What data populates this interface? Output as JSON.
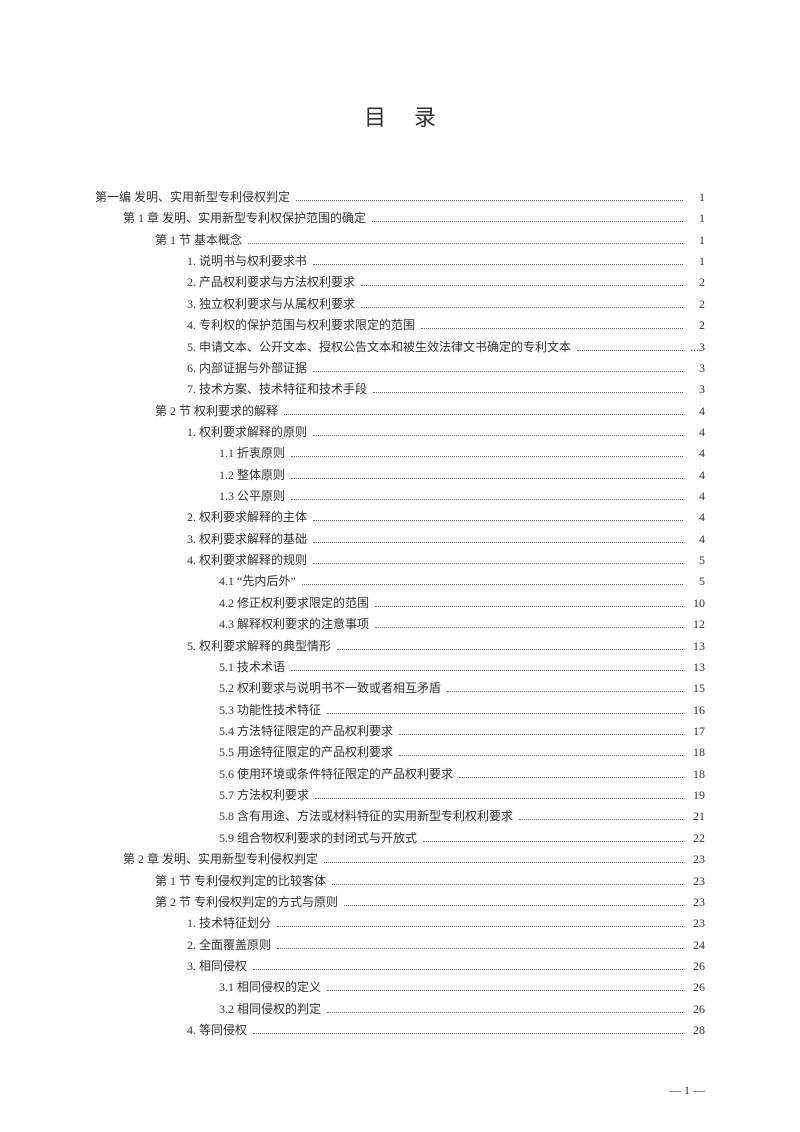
{
  "title": "目录",
  "page_footer": "— 1 —",
  "entries": [
    {
      "level": 0,
      "text": "第一编  发明、实用新型专利侵权判定",
      "page": "1"
    },
    {
      "level": 1,
      "text": "第 1 章  发明、实用新型专利权保护范围的确定",
      "page": "1"
    },
    {
      "level": 2,
      "text": "第 1 节  基本概念",
      "page": "1"
    },
    {
      "level": 3,
      "text": "1. 说明书与权利要求书",
      "page": "1"
    },
    {
      "level": 3,
      "text": "2. 产品权利要求与方法权利要求",
      "page": "2"
    },
    {
      "level": 3,
      "text": "3. 独立权利要求与从属权利要求",
      "page": "2"
    },
    {
      "level": 3,
      "text": "4. 专利权的保护范围与权利要求限定的范围",
      "page": "2"
    },
    {
      "level": 3,
      "text": "5. 申请文本、公开文本、授权公告文本和被生效法律文书确定的专利文本",
      "page": "...3"
    },
    {
      "level": 3,
      "text": "6. 内部证据与外部证据",
      "page": "3"
    },
    {
      "level": 3,
      "text": "7. 技术方案、技术特征和技术手段",
      "page": "3"
    },
    {
      "level": 2,
      "text": "第 2 节  权利要求的解释",
      "page": "4"
    },
    {
      "level": 3,
      "text": "1. 权利要求解释的原则",
      "page": "4"
    },
    {
      "level": 4,
      "text": "1.1 折衷原则",
      "page": "4"
    },
    {
      "level": 4,
      "text": "1.2 整体原则",
      "page": "4"
    },
    {
      "level": 4,
      "text": "1.3 公平原则",
      "page": "4"
    },
    {
      "level": 3,
      "text": "2. 权利要求解释的主体",
      "page": "4"
    },
    {
      "level": 3,
      "text": "3. 权利要求解释的基础",
      "page": "4"
    },
    {
      "level": 3,
      "text": "4. 权利要求解释的规则",
      "page": "5"
    },
    {
      "level": 4,
      "text": "4.1 “先内后外”",
      "page": "5"
    },
    {
      "level": 4,
      "text": "4.2 修正权利要求限定的范围",
      "page": "10"
    },
    {
      "level": 4,
      "text": "4.3 解释权利要求的注意事项",
      "page": "12"
    },
    {
      "level": 3,
      "text": "5. 权利要求解释的典型情形",
      "page": "13"
    },
    {
      "level": 4,
      "text": "5.1 技术术语",
      "page": "13"
    },
    {
      "level": 4,
      "text": "5.2 权利要求与说明书不一致或者相互矛盾",
      "page": "15"
    },
    {
      "level": 4,
      "text": "5.3 功能性技术特征",
      "page": "16"
    },
    {
      "level": 4,
      "text": "5.4 方法特征限定的产品权利要求",
      "page": "17"
    },
    {
      "level": 4,
      "text": "5.5 用途特征限定的产品权利要求",
      "page": "18"
    },
    {
      "level": 4,
      "text": "5.6 使用环境或条件特征限定的产品权利要求",
      "page": "18"
    },
    {
      "level": 4,
      "text": "5.7 方法权利要求",
      "page": "19"
    },
    {
      "level": 4,
      "text": "5.8 含有用途、方法或材料特征的实用新型专利权利要求",
      "page": "21"
    },
    {
      "level": 4,
      "text": "5.9 组合物权利要求的封闭式与开放式",
      "page": "22"
    },
    {
      "level": 1,
      "text": "第 2 章  发明、实用新型专利侵权判定",
      "page": "23"
    },
    {
      "level": 2,
      "text": "第 1 节  专利侵权判定的比较客体",
      "page": "23"
    },
    {
      "level": 2,
      "text": "第 2 节  专利侵权判定的方式与原则",
      "page": "23"
    },
    {
      "level": 3,
      "text": "1. 技术特征划分",
      "page": "23"
    },
    {
      "level": 3,
      "text": "2. 全面覆盖原则",
      "page": "24"
    },
    {
      "level": 3,
      "text": "3. 相同侵权",
      "page": "26"
    },
    {
      "level": 4,
      "text": "3.1 相同侵权的定义",
      "page": "26"
    },
    {
      "level": 4,
      "text": "3.2 相同侵权的判定",
      "page": "26"
    },
    {
      "level": 3,
      "text": "4. 等同侵权",
      "page": "28"
    }
  ]
}
